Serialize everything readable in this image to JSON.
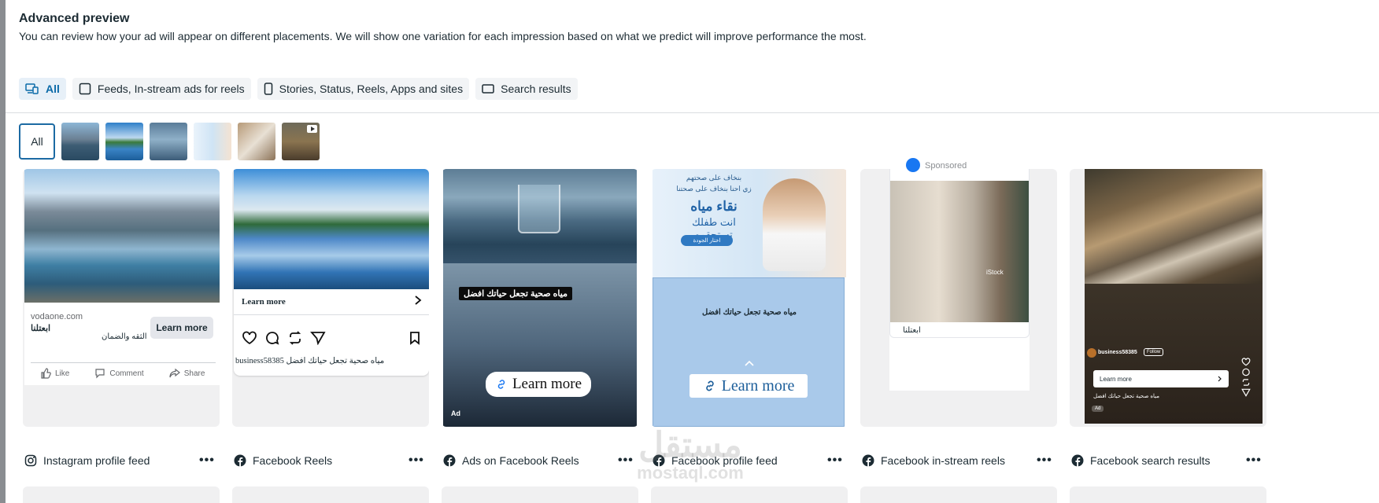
{
  "header": {
    "title": "Advanced preview",
    "subtitle": "You can review how your ad will appear on different placements. We will show one variation for each impression based on what we predict will improve performance the most."
  },
  "filters": [
    {
      "label": "All",
      "icon": "devices-icon",
      "active": true
    },
    {
      "label": "Feeds, In-stream ads for reels",
      "icon": "square-icon",
      "active": false
    },
    {
      "label": "Stories, Status, Reels, Apps and sites",
      "icon": "phone-icon",
      "active": false
    },
    {
      "label": "Search results",
      "icon": "monitor-icon",
      "active": false
    }
  ],
  "thumbnails": {
    "all_label": "All",
    "items": [
      "lake-mountain",
      "mountain-reflection",
      "water-glass",
      "kid-water-ad",
      "person-drinking",
      "waterfall-video"
    ]
  },
  "cards": {
    "c1": {
      "domain": "vodaone.com",
      "headline": "ابعتلنا",
      "description": "الثقه والضمان",
      "cta": "Learn more",
      "like": "Like",
      "comment": "Comment",
      "share": "Share",
      "label": "Instagram profile feed"
    },
    "c2": {
      "cta": "Learn more",
      "caption": "business58385 مياه صحية تجعل حياتك افضل",
      "label": "Facebook Reels"
    },
    "c3": {
      "overlay": "مياه صحية تجعل حياتك افضل",
      "cta": "Learn more",
      "ad": "Ad",
      "label": "Ads on Facebook Reels"
    },
    "c4": {
      "line1": "بنخاف على صحتهم",
      "line2": "زي احنا بنخاف على صحتنا",
      "big": "نقاء مياه",
      "mid": "انت طفلك تستحقوه",
      "pill": "اختار الجودة",
      "text": "مياه صحية تجعل حياتك افضل",
      "cta": "Learn more",
      "label": "Facebook profile feed"
    },
    "c5": {
      "sponsored": "Sponsored",
      "stock": "iStock",
      "caption": "ابعتلنا",
      "label": "Facebook in-stream reels"
    },
    "c6": {
      "user": "business58385",
      "follow": "Follow",
      "cta": "Learn more",
      "caption": "مياه صحية تجعل حياتك افضل",
      "ad": "Ad",
      "label": "Facebook search results"
    }
  },
  "more_label": "•••",
  "watermark": {
    "arabic": "مستقل",
    "latin": "mostaql.com"
  },
  "colors": {
    "accent": "#0a6aa8",
    "active_filter_bg": "#e7f0f8",
    "facebook_blue": "#1877f2"
  }
}
